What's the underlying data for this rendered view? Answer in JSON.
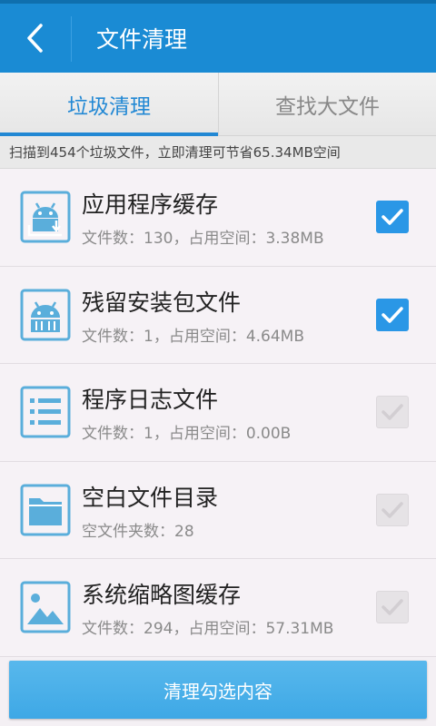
{
  "header": {
    "title": "文件清理"
  },
  "tabs": [
    {
      "label": "垃圾清理",
      "active": true
    },
    {
      "label": "查找大文件",
      "active": false
    }
  ],
  "summary": "扫描到454个垃圾文件，立即清理可节省65.34MB空间",
  "items": [
    {
      "icon": "android-cache-icon",
      "title": "应用程序缓存",
      "subtitle": "文件数：130，占用空间：3.38MB",
      "checked": true
    },
    {
      "icon": "android-package-icon",
      "title": "残留安装包文件",
      "subtitle": "文件数：1，占用空间：4.64MB",
      "checked": true
    },
    {
      "icon": "log-list-icon",
      "title": "程序日志文件",
      "subtitle": "文件数：1，占用空间：0.00B",
      "checked": false
    },
    {
      "icon": "folder-icon",
      "title": "空白文件目录",
      "subtitle": "空文件夹数：28",
      "checked": false
    },
    {
      "icon": "image-thumbnail-icon",
      "title": "系统缩略图缓存",
      "subtitle": "文件数：294，占用空间：57.31MB",
      "checked": false
    }
  ],
  "actions": {
    "clean_label": "清理勾选内容"
  },
  "colors": {
    "accent": "#1a8bd4",
    "checkbox_on": "#2a97e6",
    "icon": "#5aaedb"
  }
}
